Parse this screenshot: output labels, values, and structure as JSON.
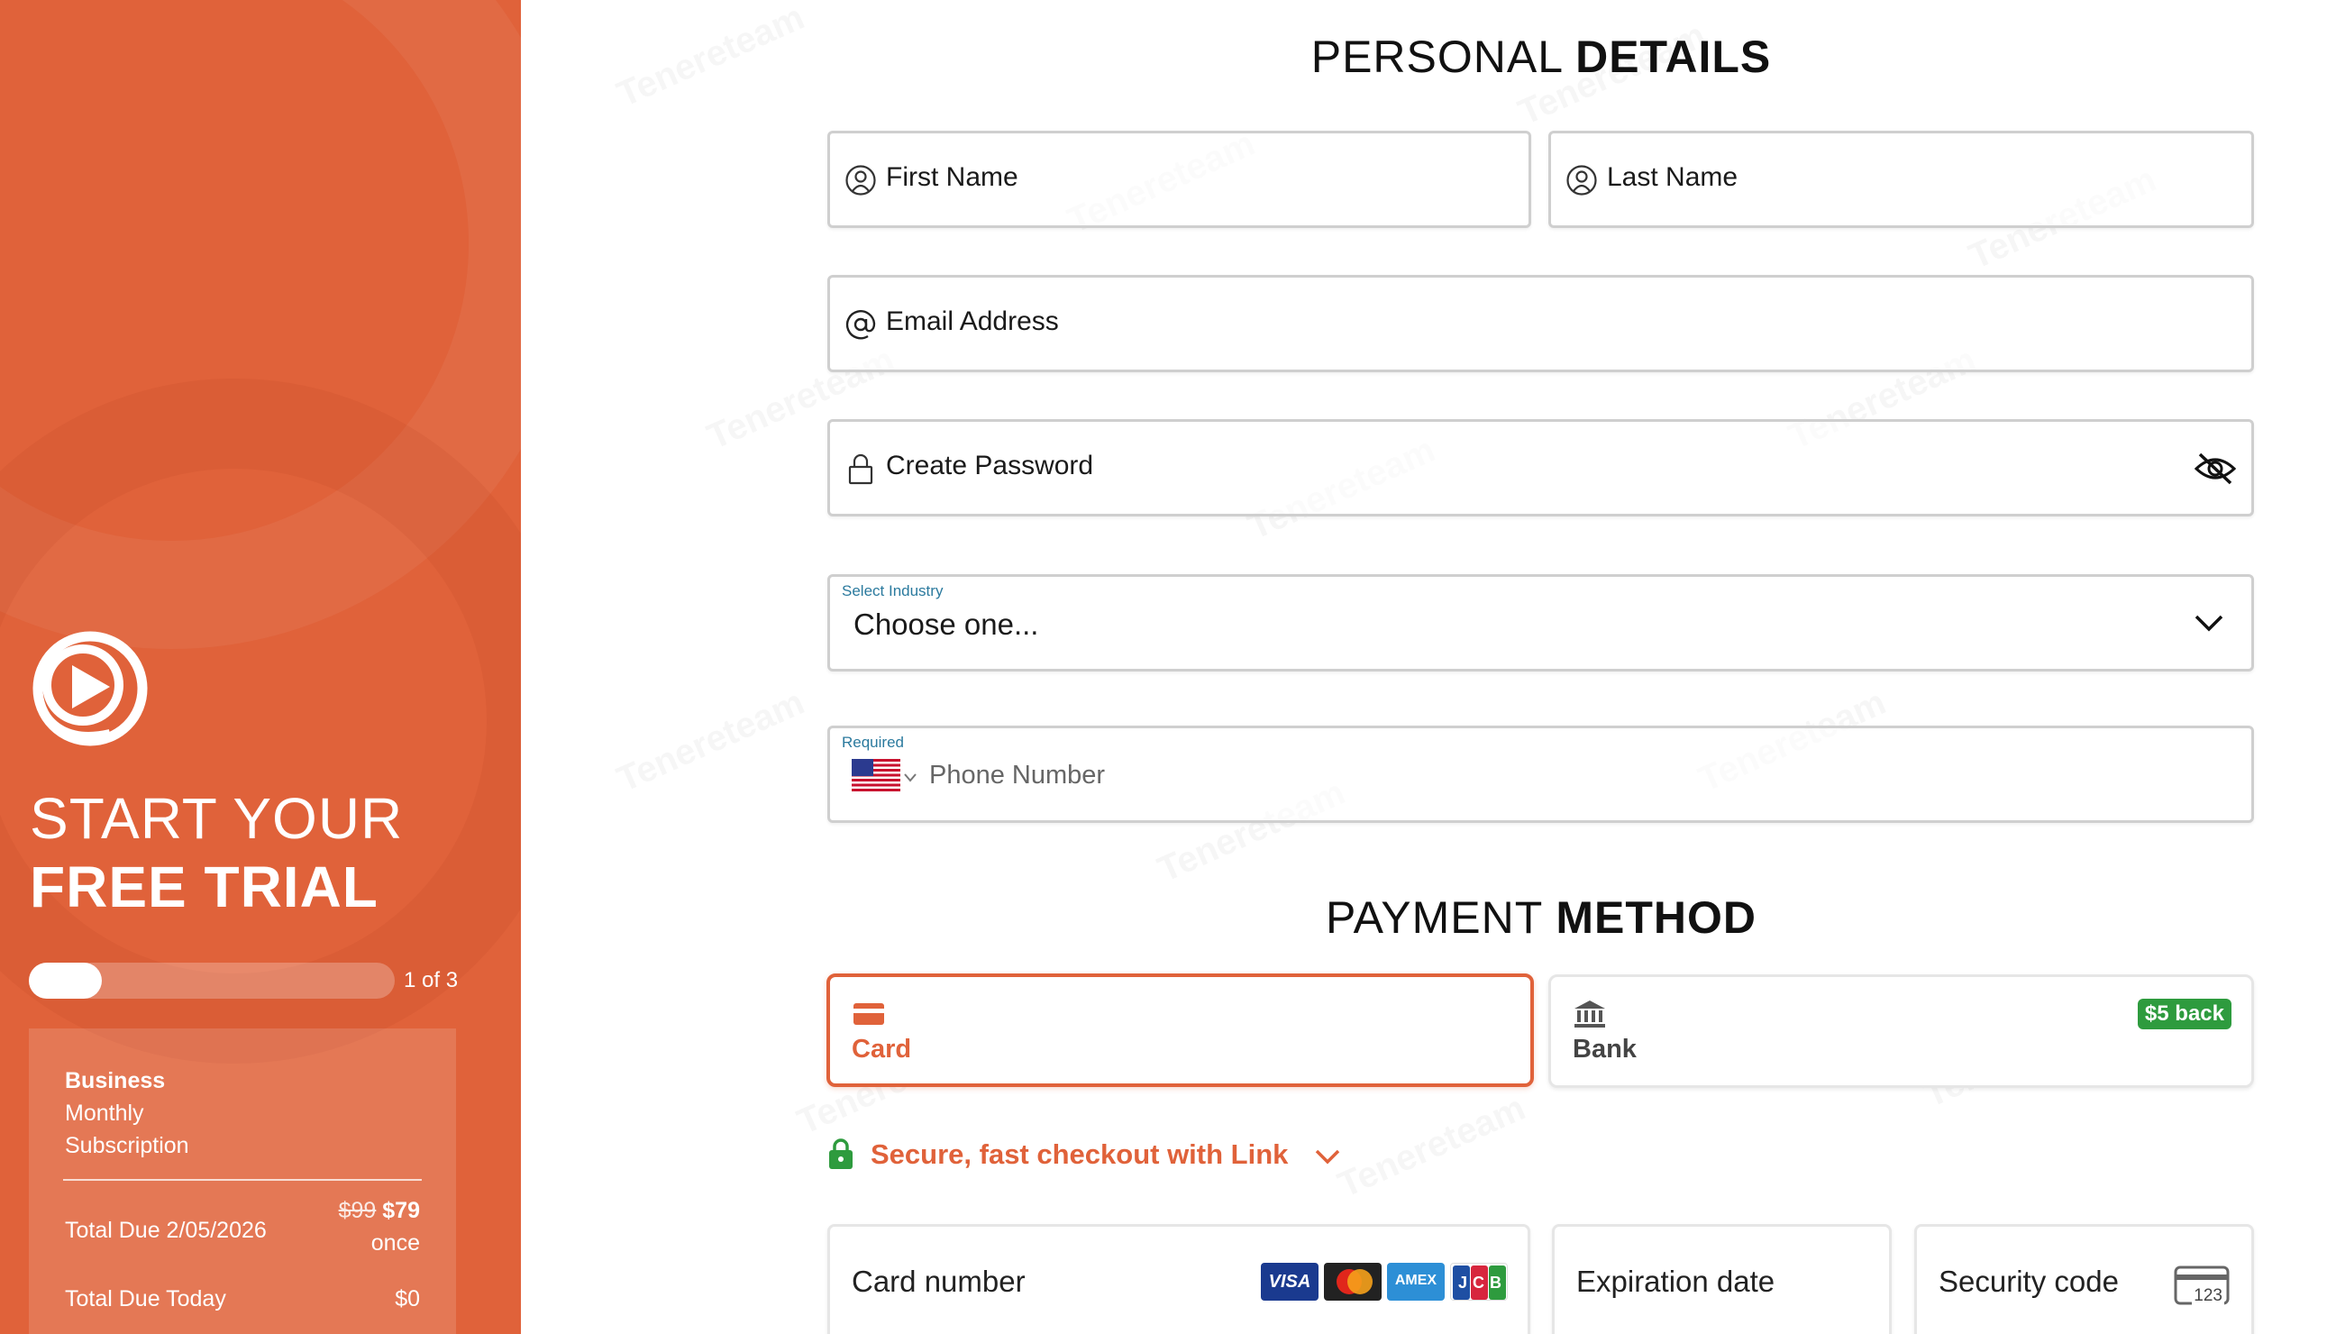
{
  "sidebar": {
    "title_line1": "START YOUR",
    "title_line2": "FREE TRIAL",
    "progress_fraction": 0.2,
    "step_label": "1 of 3",
    "plan": {
      "name": "Business",
      "period": "Monthly",
      "type": "Subscription"
    },
    "total_due_label": "Total Due 2/05/2026",
    "old_price": "$99",
    "new_price": "$79",
    "price_frequency": "once",
    "total_today_label": "Total Due Today",
    "total_today_value": "$0"
  },
  "personal": {
    "heading_light": "PERSONAL",
    "heading_bold": "DETAILS",
    "first_name_placeholder": "First Name",
    "last_name_placeholder": "Last Name",
    "email_placeholder": "Email Address",
    "password_placeholder": "Create Password",
    "industry_label": "Select Industry",
    "industry_value": "Choose one...",
    "phone_label": "Required",
    "phone_placeholder": "Phone Number"
  },
  "payment": {
    "heading_light": "PAYMENT",
    "heading_bold": "METHOD",
    "card_label": "Card",
    "bank_label": "Bank",
    "bank_badge": "$5 back",
    "link_text": "Secure, fast checkout with Link",
    "card_number_placeholder": "Card number",
    "expiration_placeholder": "Expiration date",
    "security_placeholder": "Security code",
    "card_brands": [
      "VISA",
      "mastercard",
      "AMEX",
      "JCB"
    ],
    "cvc_hint": "123"
  },
  "watermark": "Tenereteam",
  "colors": {
    "accent": "#e0623a",
    "link_green": "#2e9b3e",
    "label_blue": "#2b7a9e"
  }
}
